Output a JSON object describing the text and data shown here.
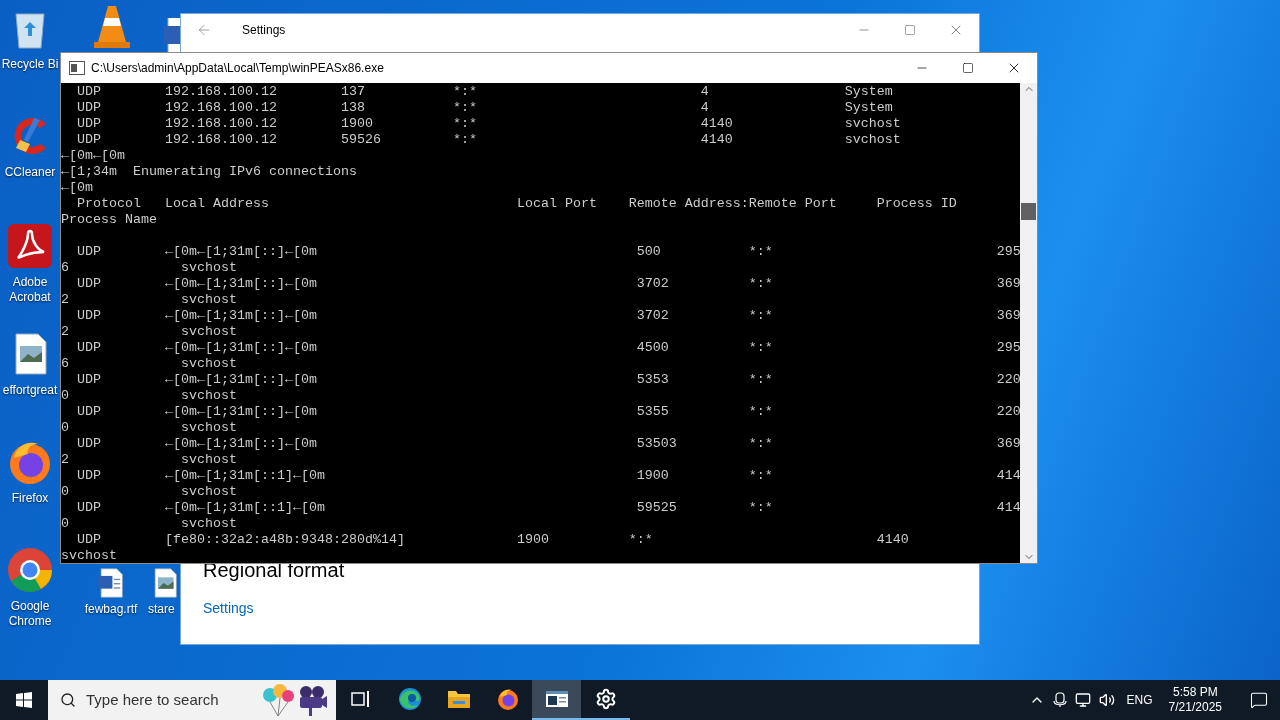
{
  "desktop_icons": [
    {
      "kind": "recycle",
      "label": "Recycle Bi"
    },
    {
      "kind": "cone"
    },
    {
      "kind": "document"
    },
    {
      "kind": "cleaner",
      "label": "CCleaner"
    },
    {
      "kind": "pdf",
      "label": "Adobe Acrobat"
    },
    {
      "kind": "image",
      "label": "effortgreat"
    },
    {
      "kind": "firefox",
      "label": "Firefox"
    },
    {
      "kind": "chrome",
      "label": "Google Chrome"
    },
    {
      "kind": "document",
      "label": "fewbag.rtf"
    },
    {
      "kind": "image",
      "label": "stare"
    }
  ],
  "settings_window": {
    "title": "Settings",
    "heading": "Regional format",
    "link": "Settings"
  },
  "console_window": {
    "title": "C:\\Users\\admin\\AppData\\Local\\Temp\\winPEASx86.exe",
    "header_lines": [
      "  UDP        192.168.100.12        137           *:*                            4                 System",
      "  UDP        192.168.100.12        138           *:*                            4                 System",
      "  UDP        192.168.100.12        1900          *:*                            4140              svchost",
      "  UDP        192.168.100.12        59526         *:*                            4140              svchost",
      "←[0m←[0m",
      "←[1;34m  Enumerating IPv6 connections",
      "←[0m",
      "  Protocol   Local Address                               Local Port    Remote Address:Remote Port     Process ID",
      "Process Name"
    ],
    "table_lines": [
      "  UDP        ←[0m←[1;31m[::]←[0m                                        500           *:*                            295",
      "6              svchost",
      "  UDP        ←[0m←[1;31m[::]←[0m                                        3702          *:*                            369",
      "2              svchost",
      "  UDP        ←[0m←[1;31m[::]←[0m                                        3702          *:*                            369",
      "2              svchost",
      "  UDP        ←[0m←[1;31m[::]←[0m                                        4500          *:*                            295",
      "6              svchost",
      "  UDP        ←[0m←[1;31m[::]←[0m                                        5353          *:*                            220",
      "0              svchost",
      "  UDP        ←[0m←[1;31m[::]←[0m                                        5355          *:*                            220",
      "0              svchost",
      "  UDP        ←[0m←[1;31m[::]←[0m                                        53503         *:*                            369",
      "2              svchost",
      "  UDP        ←[0m←[1;31m[::1]←[0m                                       1900          *:*                            414",
      "0              svchost",
      "  UDP        ←[0m←[1;31m[::1]←[0m                                       59525         *:*                            414",
      "0              svchost",
      "  UDP        [fe80::32a2:a48b:9348:280d%14]              1900          *:*                            4140",
      "svchost"
    ]
  },
  "taskbar": {
    "search_placeholder": "Type here to search",
    "apps": [
      {
        "kind": "taskview",
        "selected": false,
        "running": false
      },
      {
        "kind": "edge",
        "selected": false,
        "running": false
      },
      {
        "kind": "folder",
        "selected": false,
        "running": false
      },
      {
        "kind": "firefox",
        "selected": false,
        "running": false
      },
      {
        "kind": "console",
        "selected": true,
        "running": true
      },
      {
        "kind": "gear",
        "selected": false,
        "running": true
      }
    ],
    "language": "ENG",
    "time": "5:58 PM",
    "date": "7/21/2025"
  }
}
